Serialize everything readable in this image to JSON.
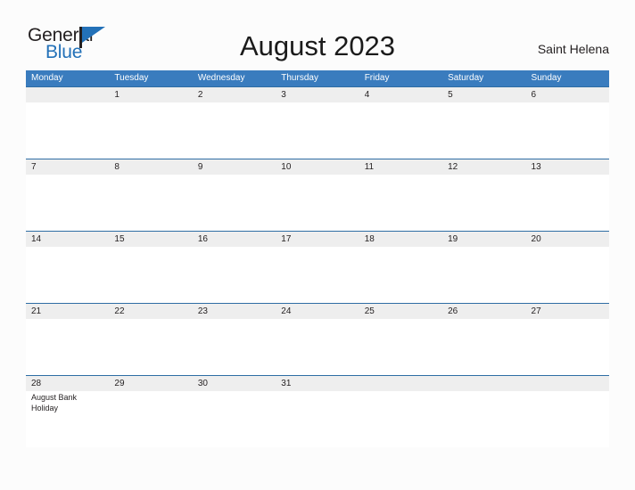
{
  "brand": {
    "name_part1": "General",
    "name_part2": "Blue",
    "logo_icon": "flag-triangle-icon",
    "accent_color": "#2371b8"
  },
  "header": {
    "title": "August 2023",
    "locale": "Saint Helena"
  },
  "calendar": {
    "header_bg_color": "#3a7cbe",
    "row_band_color": "#eeeeee",
    "row_divider_color": "#2e6da4",
    "weekdays": [
      "Monday",
      "Tuesday",
      "Wednesday",
      "Thursday",
      "Friday",
      "Saturday",
      "Sunday"
    ],
    "weeks": [
      {
        "days": [
          {
            "number": "",
            "event": ""
          },
          {
            "number": "1",
            "event": ""
          },
          {
            "number": "2",
            "event": ""
          },
          {
            "number": "3",
            "event": ""
          },
          {
            "number": "4",
            "event": ""
          },
          {
            "number": "5",
            "event": ""
          },
          {
            "number": "6",
            "event": ""
          }
        ]
      },
      {
        "days": [
          {
            "number": "7",
            "event": ""
          },
          {
            "number": "8",
            "event": ""
          },
          {
            "number": "9",
            "event": ""
          },
          {
            "number": "10",
            "event": ""
          },
          {
            "number": "11",
            "event": ""
          },
          {
            "number": "12",
            "event": ""
          },
          {
            "number": "13",
            "event": ""
          }
        ]
      },
      {
        "days": [
          {
            "number": "14",
            "event": ""
          },
          {
            "number": "15",
            "event": ""
          },
          {
            "number": "16",
            "event": ""
          },
          {
            "number": "17",
            "event": ""
          },
          {
            "number": "18",
            "event": ""
          },
          {
            "number": "19",
            "event": ""
          },
          {
            "number": "20",
            "event": ""
          }
        ]
      },
      {
        "days": [
          {
            "number": "21",
            "event": ""
          },
          {
            "number": "22",
            "event": ""
          },
          {
            "number": "23",
            "event": ""
          },
          {
            "number": "24",
            "event": ""
          },
          {
            "number": "25",
            "event": ""
          },
          {
            "number": "26",
            "event": ""
          },
          {
            "number": "27",
            "event": ""
          }
        ]
      },
      {
        "days": [
          {
            "number": "28",
            "event": "August Bank Holiday"
          },
          {
            "number": "29",
            "event": ""
          },
          {
            "number": "30",
            "event": ""
          },
          {
            "number": "31",
            "event": ""
          },
          {
            "number": "",
            "event": ""
          },
          {
            "number": "",
            "event": ""
          },
          {
            "number": "",
            "event": ""
          }
        ]
      }
    ]
  }
}
